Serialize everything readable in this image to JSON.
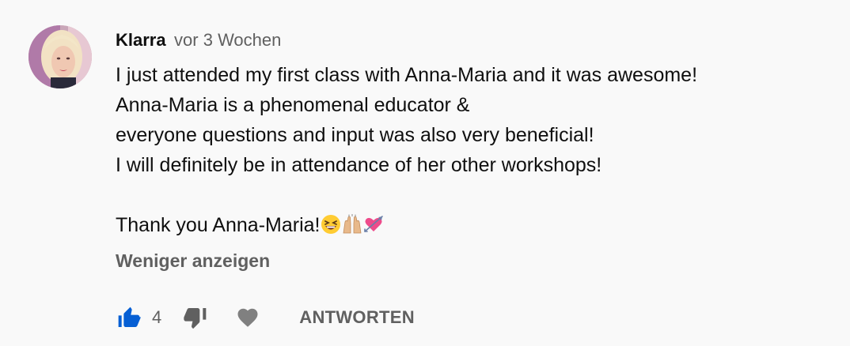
{
  "comment": {
    "author": "Klarra",
    "timestamp": "vor 3 Wochen",
    "lines": [
      "I just attended my first class with Anna-Maria and it was awesome!",
      "Anna-Maria is a phenomenal educator &",
      "everyone questions and input was also very beneficial!",
      "I will definitely be in attendance of her other workshops!"
    ],
    "closing": "Thank you Anna-Maria!",
    "emojis": [
      "grinning-squinting-face-emoji",
      "raising-hands-emoji",
      "heart-with-arrow-emoji"
    ],
    "show_less_label": "Weniger anzeigen"
  },
  "actions": {
    "like_icon": "thumbs-up-icon",
    "like_count": "4",
    "dislike_icon": "thumbs-down-icon",
    "heart_icon": "heart-icon",
    "reply_label": "ANTWORTEN"
  },
  "colors": {
    "background": "#f9f9f9",
    "like_active": "#065fd4",
    "secondary_text": "#606060",
    "primary_text": "#0f0f0f"
  }
}
